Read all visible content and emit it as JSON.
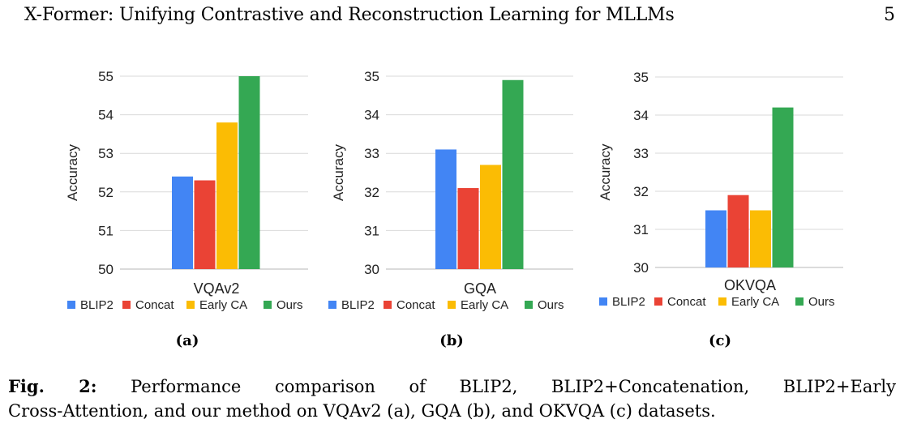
{
  "header": {
    "title": "X-Former: Unifying Contrastive and Reconstruction Learning for MLLMs",
    "page_number": "5"
  },
  "chart_data": [
    {
      "type": "bar",
      "panel_label": "(a)",
      "categories": [
        "VQAv2"
      ],
      "series": [
        {
          "name": "BLIP2",
          "color": "#4285f4",
          "values": [
            52.4
          ]
        },
        {
          "name": "Concat",
          "color": "#ea4335",
          "values": [
            52.3
          ]
        },
        {
          "name": "Early CA",
          "color": "#fbbc04",
          "values": [
            53.8
          ]
        },
        {
          "name": "Ours",
          "color": "#34a853",
          "values": [
            55.0
          ]
        }
      ],
      "title": "",
      "xlabel": "",
      "ylabel": "Accuracy",
      "ylim": [
        50,
        55
      ],
      "yticks": [
        "50",
        "51",
        "52",
        "53",
        "54",
        "55"
      ],
      "grid": true,
      "legend": "bottom"
    },
    {
      "type": "bar",
      "panel_label": "(b)",
      "categories": [
        "GQA"
      ],
      "series": [
        {
          "name": "BLIP2",
          "color": "#4285f4",
          "values": [
            33.1
          ]
        },
        {
          "name": "Concat",
          "color": "#ea4335",
          "values": [
            32.1
          ]
        },
        {
          "name": "Early CA",
          "color": "#fbbc04",
          "values": [
            32.7
          ]
        },
        {
          "name": "Ours",
          "color": "#34a853",
          "values": [
            34.9
          ]
        }
      ],
      "title": "",
      "xlabel": "",
      "ylabel": "Accuracy",
      "ylim": [
        30,
        35
      ],
      "yticks": [
        "30",
        "31",
        "32",
        "33",
        "34",
        "35"
      ],
      "grid": true,
      "legend": "bottom"
    },
    {
      "type": "bar",
      "panel_label": "(c)",
      "categories": [
        "OKVQA"
      ],
      "series": [
        {
          "name": "BLIP2",
          "color": "#4285f4",
          "values": [
            31.5
          ]
        },
        {
          "name": "Concat",
          "color": "#ea4335",
          "values": [
            31.9
          ]
        },
        {
          "name": "Early CA",
          "color": "#fbbc04",
          "values": [
            31.5
          ]
        },
        {
          "name": "Ours",
          "color": "#34a853",
          "values": [
            34.2
          ]
        }
      ],
      "title": "",
      "xlabel": "",
      "ylabel": "Accuracy",
      "ylim": [
        30,
        35
      ],
      "yticks": [
        "30",
        "31",
        "32",
        "33",
        "34",
        "35"
      ],
      "grid": true,
      "legend": "bottom"
    }
  ],
  "caption": {
    "label": "Fig. 2:",
    "line1": "Performance comparison of BLIP2, BLIP2+Concatenation, BLIP2+Early",
    "line2": "Cross-Attention, and our method on VQAv2 (a), GQA (b), and OKVQA (c) datasets."
  }
}
